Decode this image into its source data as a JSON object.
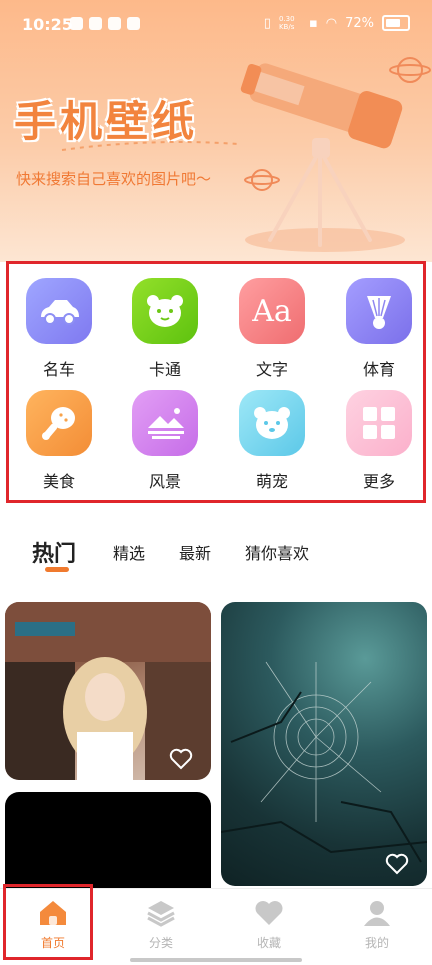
{
  "status_bar": {
    "time": "10:25",
    "net_speed": "0.30\nKB/s",
    "battery": "72%"
  },
  "hero": {
    "title": "手机壁纸",
    "subtitle": "快来搜索自己喜欢的图片吧～"
  },
  "categories": [
    {
      "label": "名车",
      "icon": "car-icon",
      "color": "#8d8ff4"
    },
    {
      "label": "卡通",
      "icon": "bear-icon",
      "color": "#7cd51c"
    },
    {
      "label": "文字",
      "icon": "text-aa-icon",
      "color": "#f47e80"
    },
    {
      "label": "体育",
      "icon": "badminton-icon",
      "color": "#8f86f0"
    },
    {
      "label": "美食",
      "icon": "drumstick-icon",
      "color": "#f8a24a"
    },
    {
      "label": "风景",
      "icon": "landscape-icon",
      "color": "#d686ef"
    },
    {
      "label": "萌宠",
      "icon": "pet-icon",
      "color": "#7fd8ef"
    },
    {
      "label": "更多",
      "icon": "grid-icon",
      "color": "#fdbfd6"
    }
  ],
  "tabs": [
    {
      "label": "热门",
      "active": true
    },
    {
      "label": "精选"
    },
    {
      "label": "最新"
    },
    {
      "label": "猜你喜欢"
    }
  ],
  "nav": [
    {
      "label": "首页",
      "icon": "home-icon",
      "active": true
    },
    {
      "label": "分类",
      "icon": "layers-icon"
    },
    {
      "label": "收藏",
      "icon": "heart-icon"
    },
    {
      "label": "我的",
      "icon": "user-icon"
    }
  ],
  "colors": {
    "accent": "#f07a2e",
    "highlight_border": "#e0262b"
  }
}
